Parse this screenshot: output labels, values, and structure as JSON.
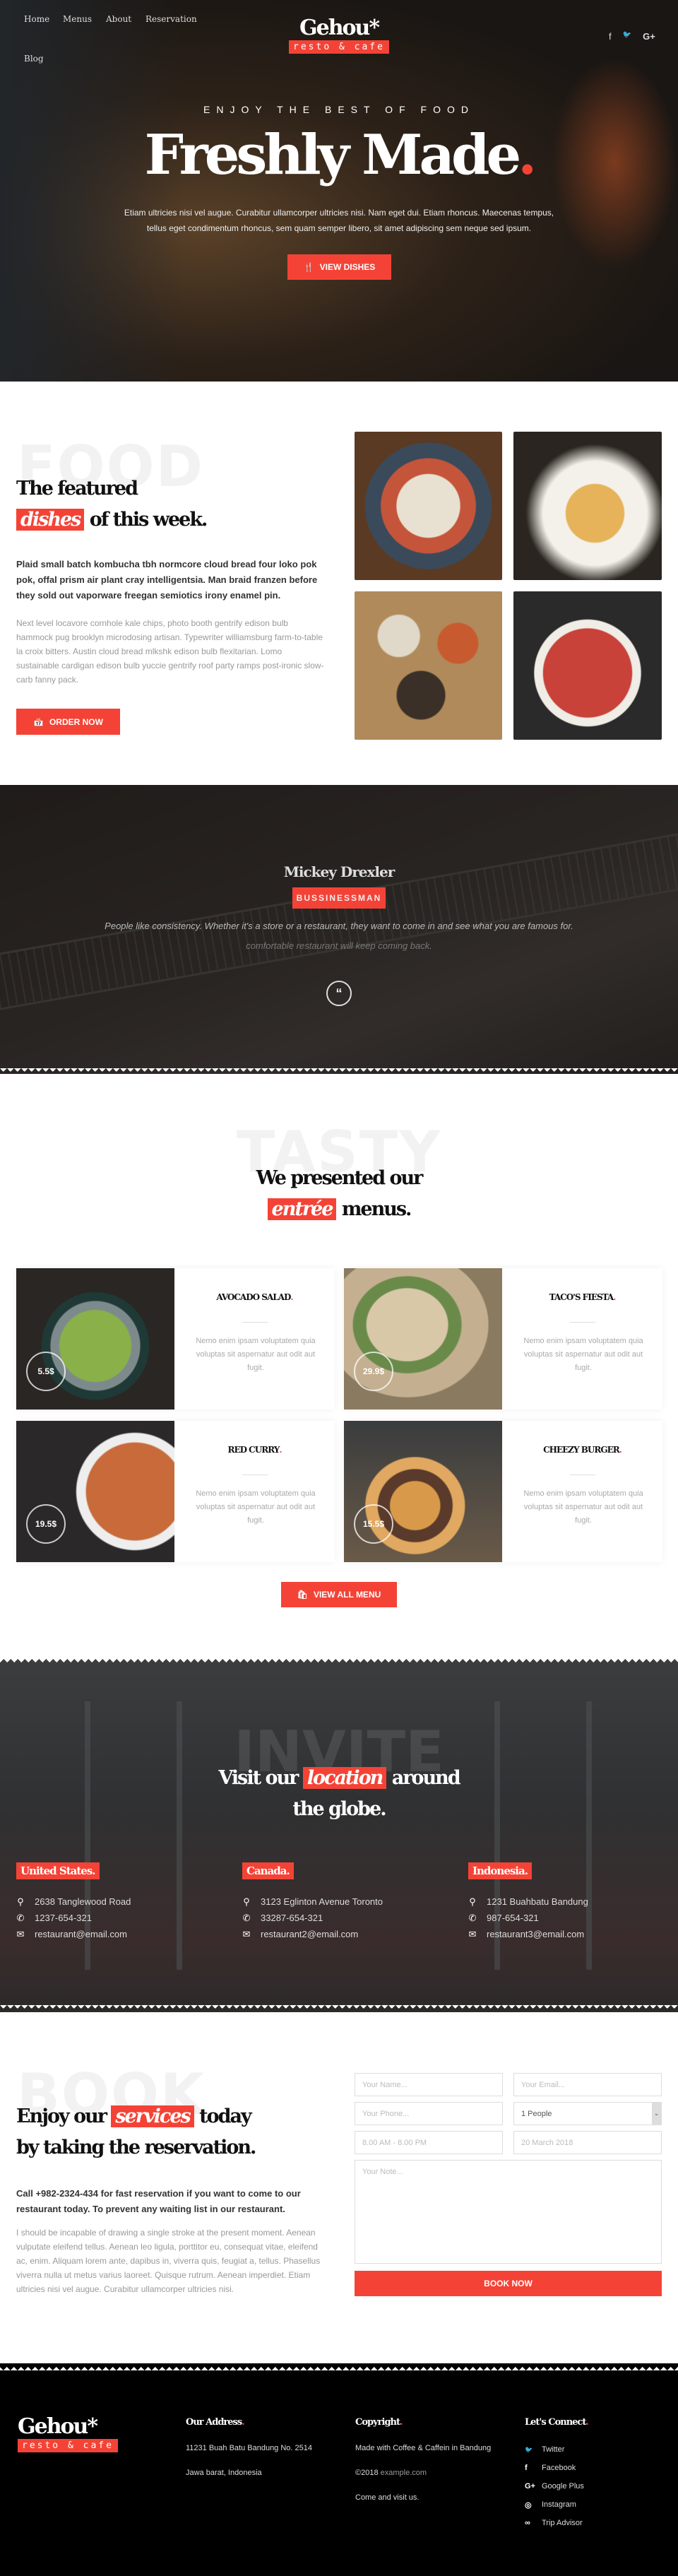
{
  "colors": {
    "accent": "#f44336",
    "footer_bg": "#000000"
  },
  "header": {
    "nav": [
      "Home",
      "Menus",
      "About",
      "Reservation",
      "Blog"
    ],
    "logo": {
      "name": "Gehou*",
      "tagline": "resto & cafe"
    },
    "social": [
      {
        "icon": "facebook-icon",
        "glyph": "f"
      },
      {
        "icon": "twitter-icon",
        "glyph": "🐦"
      },
      {
        "icon": "google-plus-icon",
        "glyph": "G+"
      }
    ]
  },
  "hero": {
    "kicker": "ENJOY THE BEST OF FOOD",
    "title": "Freshly Made",
    "title_dot": ".",
    "text": "Etiam ultricies nisi vel augue. Curabitur ullamcorper ultricies nisi. Nam eget dui. Etiam rhoncus. Maecenas tempus, tellus eget condimentum rhoncus, sem quam semper libero, sit amet adipiscing sem neque sed ipsum.",
    "button": "VIEW DISHES",
    "button_icon": "cutlery-icon"
  },
  "featured": {
    "watermark": "FOOD",
    "title_line1": "The featured",
    "title_highlight": "dishes",
    "title_line2": "of this week.",
    "lead": "Plaid small batch kombucha tbh normcore cloud bread four loko pok pok, offal prism air plant cray intelligentsia. Man braid franzen before they sold out vaporware freegan semiotics irony enamel pin.",
    "body": "Next level locavore cornhole kale chips, photo booth gentrify edison bulb hammock pug brooklyn microdosing artisan. Typewriter williamsburg farm-to-table la croix bitters. Austin cloud bread mlkshk edison bulb flexitarian. Lomo sustainable cardigan edison bulb yuccie gentrify roof party ramps post-ironic slow-carb fanny pack.",
    "button": "ORDER NOW",
    "button_icon": "calendar-icon"
  },
  "testimonial": {
    "name": "Mickey Drexler",
    "role": "BUSSINESSMAN",
    "quote": "People like consistency. Whether it's a store or a restaurant, they want to come in and see what you are famous for.",
    "quote_next": "comfortable restaurant will keep coming back.",
    "icon": "quote-icon"
  },
  "menu": {
    "watermark": "TASTY",
    "title_line1": "We presented our",
    "title_highlight": "entrée",
    "title_line2": "menus.",
    "items": [
      {
        "name": "AVOCADO SALAD",
        "price": "5.5$",
        "desc": "Nemo enim ipsam voluptatem quia voluptas sit aspernatur aut odit aut fugit."
      },
      {
        "name": "TACO'S FIESTA",
        "price": "29.9$",
        "desc": "Nemo enim ipsam voluptatem quia voluptas sit aspernatur aut odit aut fugit."
      },
      {
        "name": "RED CURRY",
        "price": "19.5$",
        "desc": "Nemo enim ipsam voluptatem quia voluptas sit aspernatur aut odit aut fugit."
      },
      {
        "name": "CHEEZY BURGER",
        "price": "15.5$",
        "desc": "Nemo enim ipsam voluptatem quia voluptas sit aspernatur aut odit aut fugit."
      }
    ],
    "button": "VIEW ALL MENU",
    "button_icon": "shopping-bag-icon"
  },
  "locations": {
    "watermark": "INVITE",
    "title_pre": "Visit our",
    "title_highlight": "location",
    "title_post": "around",
    "title_line2": "the globe.",
    "items": [
      {
        "country": "United States.",
        "address": "2638 Tanglewood Road",
        "phone": "1237-654-321",
        "email": "restaurant@email.com"
      },
      {
        "country": "Canada.",
        "address": "3123 Eglinton Avenue Toronto",
        "phone": "33287-654-321",
        "email": "restaurant2@email.com"
      },
      {
        "country": "Indonesia.",
        "address": "1231 Buahbatu Bandung",
        "phone": "987-654-321",
        "email": "restaurant3@email.com"
      }
    ]
  },
  "reservation": {
    "watermark": "BOOK",
    "title_pre": "Enjoy our",
    "title_highlight": "services",
    "title_post": "today",
    "title_line2": "by taking the reservation.",
    "lead": "Call +982-2324-434 for fast reservation if you want to come to our restaurant today. To prevent any waiting list in our restaurant.",
    "body": "I should be incapable of drawing a single stroke at the present moment.  Aenean vulputate eleifend tellus. Aenean leo ligula, porttitor eu, consequat vitae, eleifend ac, enim. Aliquam lorem ante, dapibus in, viverra quis, feugiat a, tellus. Phasellus viverra nulla ut metus varius laoreet. Quisque rutrum. Aenean imperdiet. Etiam ultricies nisi vel augue. Curabitur ullamcorper ultricies nisi.",
    "form": {
      "name_placeholder": "Your Name...",
      "email_placeholder": "Your Email...",
      "phone_placeholder": "Your Phone...",
      "people_selected": "1 People",
      "time_placeholder": "8.00 AM - 8.00 PM",
      "date_placeholder": "20 March 2018",
      "note_placeholder": "Your Note...",
      "submit": "BOOK NOW"
    }
  },
  "footer": {
    "logo": {
      "name": "Gehou*",
      "tagline": "resto & cafe"
    },
    "address": {
      "title": "Our Address",
      "line1": "11231 Buah Batu Bandung  No. 2514",
      "line2": "Jawa barat, Indonesia"
    },
    "copyright": {
      "title": "Copyright",
      "line1": "Made with Coffee & Caffein in Bandung",
      "line2_prefix": "©2018 ",
      "line2_link": "example.com",
      "line3": "Come and visit us."
    },
    "connect": {
      "title": "Let's Connect",
      "links": [
        {
          "label": "Twitter",
          "icon": "twitter-icon",
          "glyph": "🐦"
        },
        {
          "label": "Facebook",
          "icon": "facebook-icon",
          "glyph": "f"
        },
        {
          "label": "Google Plus",
          "icon": "google-plus-icon",
          "glyph": "G+"
        },
        {
          "label": "Instagram",
          "icon": "instagram-icon",
          "glyph": "◎"
        },
        {
          "label": "Trip Advisor",
          "icon": "tripadvisor-icon",
          "glyph": "∞"
        }
      ]
    }
  }
}
